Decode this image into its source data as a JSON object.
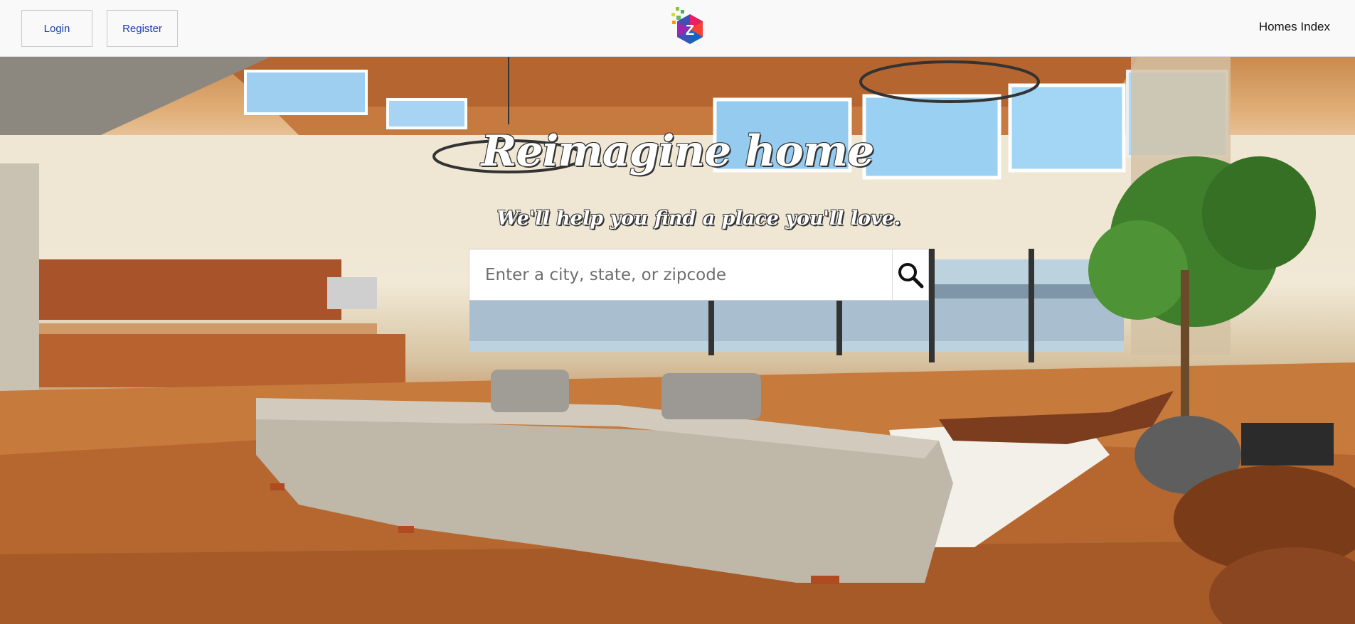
{
  "header": {
    "login_label": "Login",
    "register_label": "Register",
    "homes_index_label": "Homes Index",
    "logo_icon": "z-logo-icon"
  },
  "hero": {
    "headline": "Reimagine home",
    "tagline": "We'll help you find a place you'll love.",
    "search": {
      "placeholder": "Enter a city, state, or zipcode",
      "value": "",
      "button_icon": "search-icon"
    }
  },
  "colors": {
    "link": "#1a3ea8",
    "header_bg": "#f9f9f9"
  }
}
